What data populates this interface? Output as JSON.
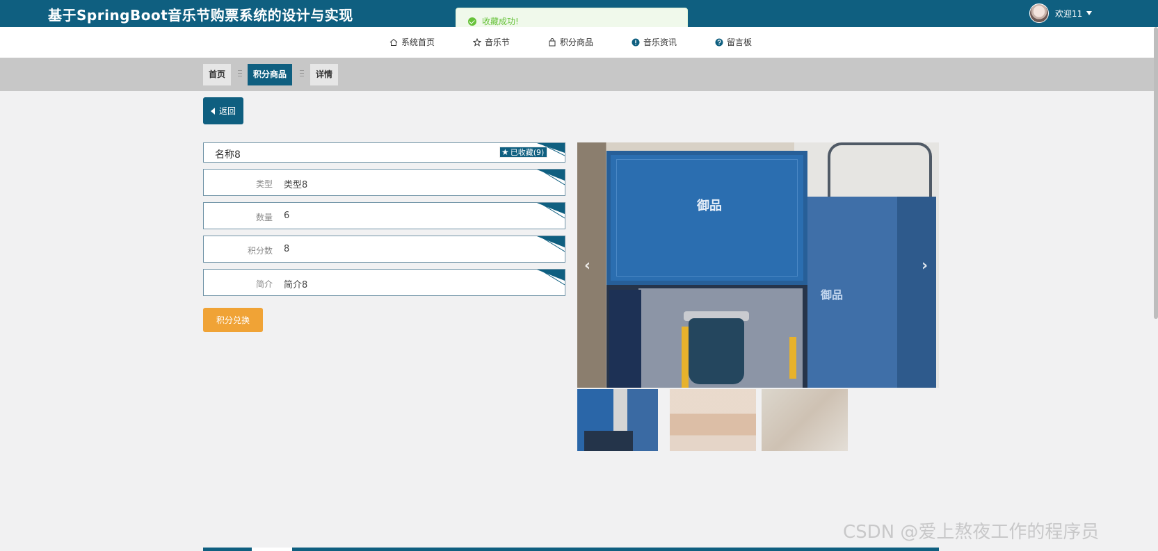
{
  "header": {
    "title": "基于SpringBoot音乐节购票系统的设计与实现",
    "welcome": "欢迎11"
  },
  "toast": {
    "message": "收藏成功!"
  },
  "nav": {
    "items": [
      {
        "label": "系统首页",
        "icon": "home-icon"
      },
      {
        "label": "音乐节",
        "icon": "star-icon"
      },
      {
        "label": "积分商品",
        "icon": "bag-icon"
      },
      {
        "label": "音乐资讯",
        "icon": "info-icon"
      },
      {
        "label": "留言板",
        "icon": "question-icon"
      }
    ]
  },
  "breadcrumb": {
    "items": [
      "首页",
      "积分商品",
      "详情"
    ]
  },
  "back_label": "返回",
  "detail": {
    "name": "名称8",
    "favorite_label": "已收藏(9)",
    "fields": [
      {
        "label": "类型",
        "value": "类型8"
      },
      {
        "label": "数量",
        "value": "6"
      },
      {
        "label": "积分数",
        "value": "8"
      },
      {
        "label": "简介",
        "value": "简介8"
      }
    ]
  },
  "exchange_label": "积分兑换",
  "product_image": {
    "logo_text": "御品"
  },
  "watermark": "CSDN @爱上熬夜工作的程序员",
  "colors": {
    "primary": "#0f5f80",
    "accent": "#f0a336",
    "success": "#67c23a"
  }
}
